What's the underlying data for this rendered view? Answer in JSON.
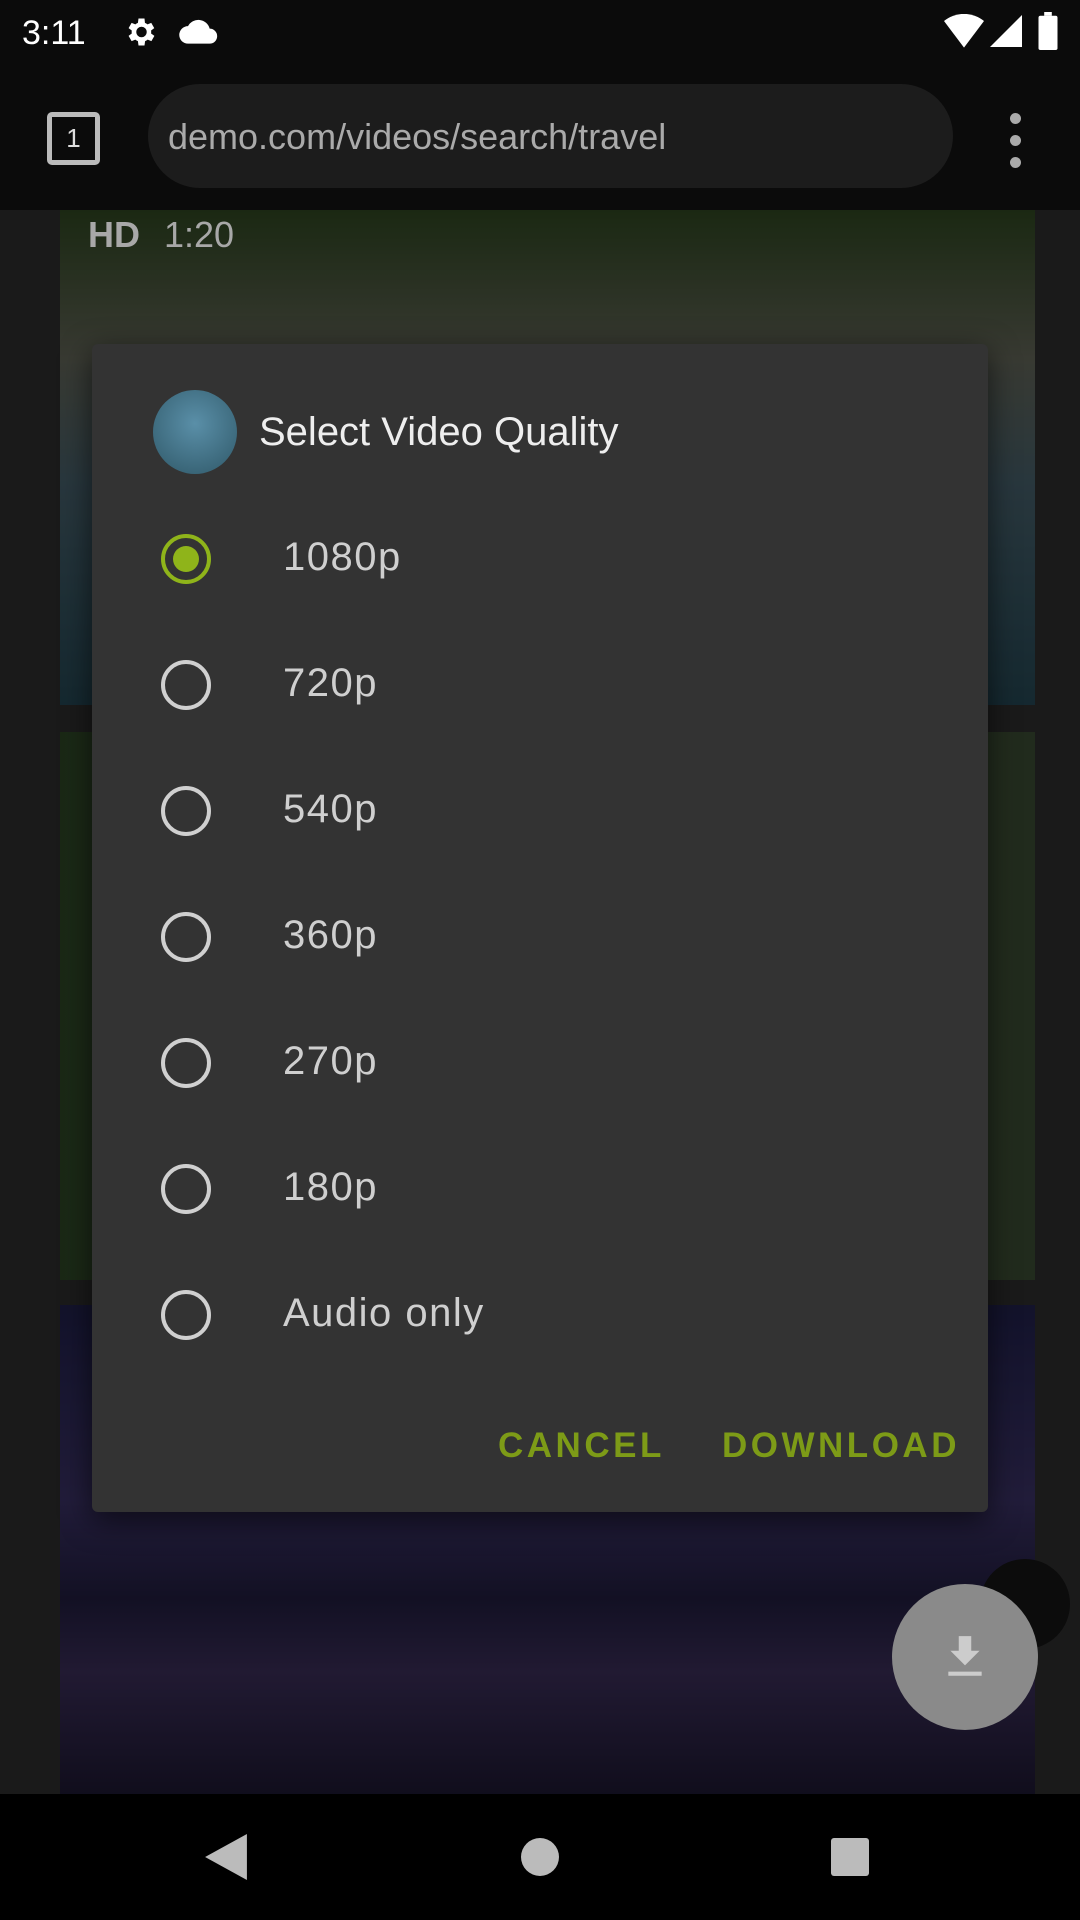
{
  "status_bar": {
    "time": "3:11",
    "icons": [
      "settings-icon",
      "cloud-icon",
      "wifi-icon",
      "signal-icon",
      "battery-icon"
    ]
  },
  "browser": {
    "tab_count": "1",
    "url": "demo.com/videos/search/travel",
    "menu_icon": "more-vert-icon"
  },
  "background": {
    "card1_badge": "HD",
    "card1_duration": "1:20"
  },
  "dialog": {
    "title": "Select Video Quality",
    "options": [
      {
        "label": "1080p",
        "selected": true
      },
      {
        "label": "720p",
        "selected": false
      },
      {
        "label": "540p",
        "selected": false
      },
      {
        "label": "360p",
        "selected": false
      },
      {
        "label": "270p",
        "selected": false
      },
      {
        "label": "180p",
        "selected": false
      },
      {
        "label": "Audio only",
        "selected": false
      }
    ],
    "cancel_label": "CANCEL",
    "download_label": "DOWNLOAD"
  },
  "colors": {
    "accent": "#8fb41a",
    "dialog_bg": "#333333"
  },
  "fab": {
    "icon": "download-icon"
  }
}
